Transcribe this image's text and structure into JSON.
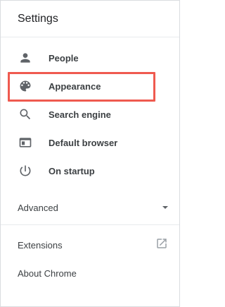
{
  "header": {
    "title": "Settings"
  },
  "menu": {
    "items": [
      {
        "label": "People",
        "icon": "person-icon"
      },
      {
        "label": "Appearance",
        "icon": "palette-icon"
      },
      {
        "label": "Search engine",
        "icon": "search-icon"
      },
      {
        "label": "Default browser",
        "icon": "browser-window-icon"
      },
      {
        "label": "On startup",
        "icon": "power-icon"
      }
    ],
    "highlighted_item": "Appearance",
    "highlight_color": "#ef5a4f"
  },
  "advanced": {
    "label": "Advanced",
    "icon": "caret-down-icon"
  },
  "footer": {
    "extensions_label": "Extensions",
    "extensions_icon": "open-in-new-icon",
    "about_label": "About Chrome"
  }
}
